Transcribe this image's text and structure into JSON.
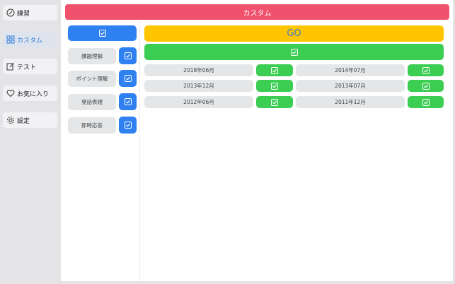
{
  "sidebar": {
    "items": [
      {
        "label": "練習",
        "icon": "pencil-circle-icon",
        "active": false
      },
      {
        "label": "カスタム",
        "icon": "grid-icon",
        "active": true
      },
      {
        "label": "テスト",
        "icon": "edit-square-icon",
        "active": false
      },
      {
        "label": "お気に入り",
        "icon": "heart-icon",
        "active": false
      },
      {
        "label": "設定",
        "icon": "gear-icon",
        "active": false
      }
    ]
  },
  "header": {
    "title": "カスタム",
    "color": "#f0516c"
  },
  "categories": {
    "select_all_checked": true,
    "items": [
      {
        "label": "課題理解",
        "checked": true
      },
      {
        "label": "ポイント理解",
        "checked": true
      },
      {
        "label": "発話表現",
        "checked": true
      },
      {
        "label": "即時応答",
        "checked": true
      }
    ]
  },
  "go_button": {
    "label": "GO",
    "color": "#ffc600"
  },
  "exams": {
    "select_all_checked": true,
    "rows": [
      [
        {
          "label": "2018年06月",
          "checked": true
        },
        {
          "label": "2014年07月",
          "checked": true
        }
      ],
      [
        {
          "label": "2013年12月",
          "checked": true
        },
        {
          "label": "2013年07月",
          "checked": true
        }
      ],
      [
        {
          "label": "2012年06月",
          "checked": true
        },
        {
          "label": "2011年12月",
          "checked": true
        }
      ]
    ]
  },
  "colors": {
    "blue": "#2f80f0",
    "green": "#3ccd53",
    "gray": "#e4e6e8"
  }
}
